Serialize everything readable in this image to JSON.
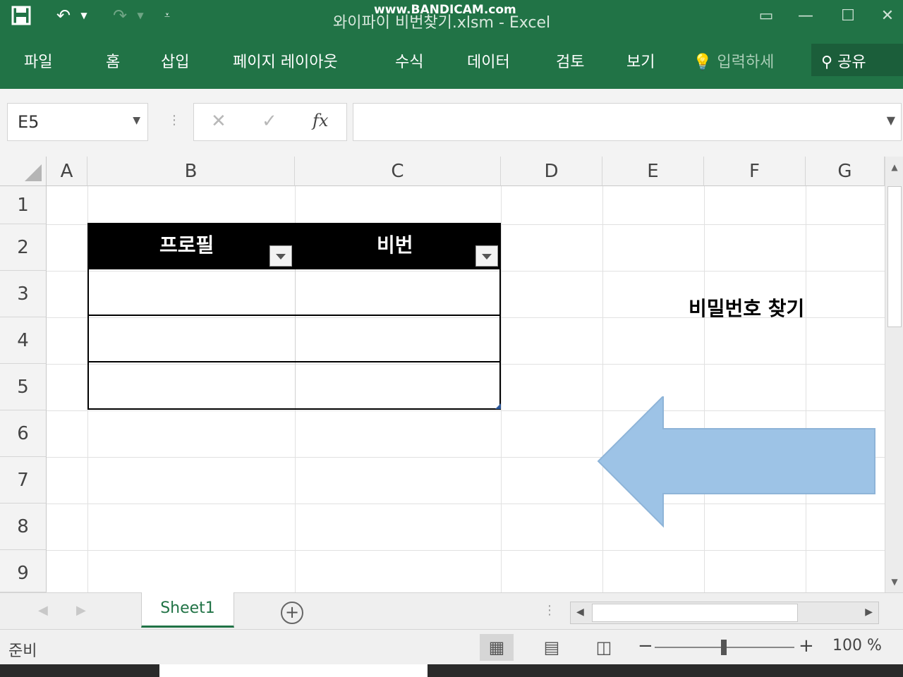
{
  "title_bar": {
    "file_title": "와이파이 비번찾기.xlsm",
    "separator": "-",
    "app_name": "Excel",
    "watermark": "www.BANDICAM.com"
  },
  "ribbon": {
    "tabs": [
      "파일",
      "홈",
      "삽입",
      "페이지 레이아웃",
      "수식",
      "데이터",
      "검토",
      "보기"
    ],
    "tell_me": "입력하세",
    "share": "공유"
  },
  "formula_bar": {
    "name_box": "E5",
    "fx": "fx",
    "formula": ""
  },
  "columns": [
    "A",
    "B",
    "C",
    "D",
    "E",
    "F",
    "G"
  ],
  "rows": [
    "1",
    "2",
    "3",
    "4",
    "5",
    "6",
    "7",
    "8",
    "9"
  ],
  "table": {
    "headers": [
      "프로필",
      "비번"
    ],
    "rows": [
      [
        "",
        ""
      ],
      [
        "",
        ""
      ],
      [
        "",
        ""
      ]
    ]
  },
  "shape": {
    "label": "비밀번호 찾기",
    "fill": "#9dc3e6"
  },
  "sheet_tabs": [
    "Sheet1"
  ],
  "status": {
    "ready": "준비",
    "zoom": "100 %"
  },
  "colors": {
    "excel_green": "#217346",
    "header_black": "#000000"
  }
}
